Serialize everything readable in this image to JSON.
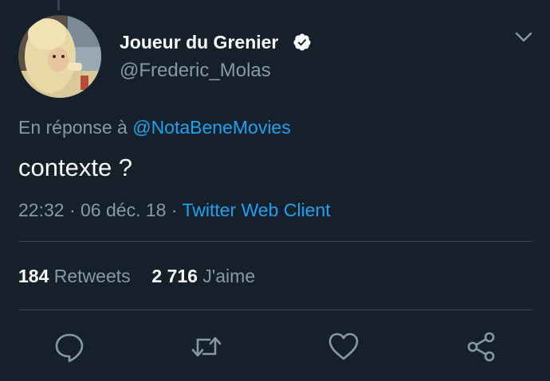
{
  "tweet": {
    "author": {
      "display_name": "Joueur du Grenier",
      "handle": "@Frederic_Molas",
      "verified": true,
      "avatar_icon": "profile-photo"
    },
    "reply_to": {
      "prefix": "En réponse à ",
      "mention": "@NotaBeneMovies"
    },
    "text": "contexte ?",
    "time": "22:32",
    "separator": " · ",
    "date": "06 déc. 18",
    "client": "Twitter Web Client",
    "stats": {
      "retweets_count": "184",
      "retweets_label": "Retweets",
      "likes_count": "2 716",
      "likes_label": "J'aime"
    }
  },
  "actions": [
    {
      "icon": "reply-icon"
    },
    {
      "icon": "retweet-icon"
    },
    {
      "icon": "like-icon"
    },
    {
      "icon": "share-icon"
    }
  ],
  "colors": {
    "background": "#15202b",
    "primary_text": "#ffffff",
    "secondary_text": "#8899a6",
    "accent": "#1da1f2",
    "divider": "#38444d"
  }
}
